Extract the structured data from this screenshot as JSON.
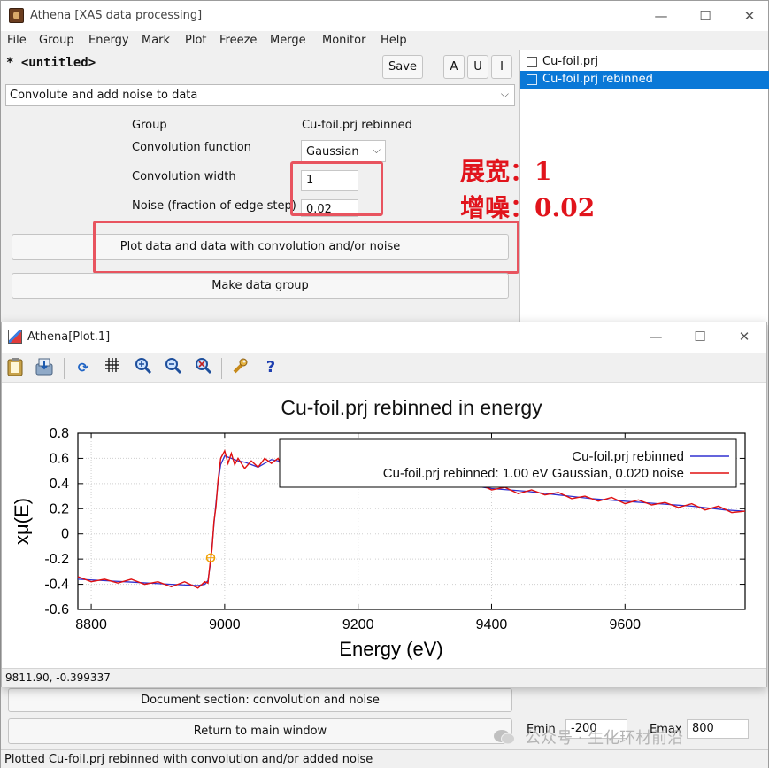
{
  "window": {
    "title": "Athena [XAS data processing]",
    "controls": {
      "minimize": "—",
      "maximize": "☐",
      "close": "✕"
    }
  },
  "menu": [
    "File",
    "Group",
    "Energy",
    "Mark",
    "Plot",
    "Freeze",
    "Merge",
    "Monitor",
    "Help"
  ],
  "project": {
    "name": "* <untitled>",
    "save_label": "Save",
    "a_label": "A",
    "u_label": "U",
    "i_label": "I"
  },
  "groups": [
    {
      "label": "Cu-foil.prj",
      "selected": false
    },
    {
      "label": "Cu-foil.prj rebinned",
      "selected": true
    }
  ],
  "tool_select": {
    "value": "Convolute and add noise to data"
  },
  "form": {
    "group_label": "Group",
    "group_value": "Cu-foil.prj rebinned",
    "function_label": "Convolution function",
    "function_value": "Gaussian",
    "width_label": "Convolution width",
    "width_value": "1",
    "noise_label": "Noise (fraction of edge step)",
    "noise_value": "0.02"
  },
  "buttons": {
    "plot": "Plot data and data with convolution and/or noise",
    "make_group": "Make data group",
    "document": "Document section: convolution and noise",
    "return": "Return to main window"
  },
  "annotations": {
    "line1": "展宽：1",
    "line2": "增噪：0.02"
  },
  "plot_window": {
    "title": "Athena[Plot.1]",
    "coordinates": "9811.90, -0.399337"
  },
  "emin": {
    "label": "Emin",
    "value": "-200"
  },
  "emax": {
    "label": "Emax",
    "value": "800"
  },
  "status": "Plotted Cu-foil.prj rebinned with convolution and/or added noise",
  "watermark": "公众号 · 生化环材前沿",
  "colors": {
    "selection": "#0a78d7",
    "highlight_box": "#e8545f",
    "annotation": "#e1141c",
    "series_original": "#3030d0",
    "series_noisy": "#e01010"
  },
  "chart_data": {
    "type": "line",
    "title": "Cu-foil.prj rebinned in energy",
    "xlabel": "Energy (eV)",
    "ylabel": "xμ(E)",
    "xlim": [
      8780,
      9780
    ],
    "ylim": [
      -0.6,
      0.8
    ],
    "xticks": [
      8800,
      9000,
      9200,
      9400,
      9600
    ],
    "yticks": [
      -0.6,
      -0.4,
      -0.2,
      0,
      0.2,
      0.4,
      0.6,
      0.8
    ],
    "grid": true,
    "legend_position": "top-right",
    "marker": {
      "x": 8979,
      "y": -0.19
    },
    "series": [
      {
        "name": "Cu-foil.prj rebinned",
        "color": "#3030d0",
        "x": [
          8780,
          8850,
          8920,
          8960,
          8970,
          8975,
          8978,
          8981,
          8984,
          8987,
          8990,
          8994,
          9000,
          9010,
          9020,
          9030,
          9040,
          9050,
          9060,
          9070,
          9080,
          9090,
          9100,
          9110,
          9120,
          9130,
          9140,
          9150,
          9160,
          9170,
          9180,
          9190,
          9200,
          9220,
          9240,
          9260,
          9280,
          9300,
          9350,
          9400,
          9450,
          9500,
          9550,
          9600,
          9650,
          9700,
          9750,
          9780
        ],
        "y": [
          -0.36,
          -0.38,
          -0.4,
          -0.41,
          -0.4,
          -0.37,
          -0.26,
          -0.1,
          0.08,
          0.25,
          0.4,
          0.55,
          0.62,
          0.6,
          0.58,
          0.57,
          0.55,
          0.53,
          0.56,
          0.59,
          0.58,
          0.53,
          0.45,
          0.51,
          0.57,
          0.59,
          0.56,
          0.42,
          0.46,
          0.52,
          0.54,
          0.51,
          0.47,
          0.49,
          0.47,
          0.46,
          0.45,
          0.44,
          0.4,
          0.36,
          0.34,
          0.31,
          0.28,
          0.26,
          0.24,
          0.22,
          0.19,
          0.18
        ]
      },
      {
        "name": "Cu-foil.prj rebinned: 1.00 eV Gaussian, 0.020 noise",
        "color": "#e01010",
        "x": [
          8780,
          8800,
          8820,
          8840,
          8860,
          8880,
          8900,
          8920,
          8940,
          8960,
          8970,
          8975,
          8978,
          8981,
          8984,
          8987,
          8990,
          8994,
          9000,
          9005,
          9010,
          9015,
          9020,
          9030,
          9040,
          9050,
          9060,
          9070,
          9080,
          9090,
          9100,
          9110,
          9120,
          9130,
          9140,
          9150,
          9160,
          9170,
          9180,
          9190,
          9200,
          9210,
          9220,
          9240,
          9260,
          9280,
          9300,
          9320,
          9340,
          9360,
          9380,
          9400,
          9420,
          9440,
          9460,
          9480,
          9500,
          9520,
          9540,
          9560,
          9580,
          9600,
          9620,
          9640,
          9660,
          9680,
          9700,
          9720,
          9740,
          9760,
          9780
        ],
        "y": [
          -0.34,
          -0.38,
          -0.36,
          -0.39,
          -0.36,
          -0.4,
          -0.38,
          -0.42,
          -0.38,
          -0.43,
          -0.38,
          -0.39,
          -0.24,
          -0.12,
          0.1,
          0.22,
          0.42,
          0.6,
          0.66,
          0.56,
          0.64,
          0.55,
          0.6,
          0.52,
          0.58,
          0.53,
          0.6,
          0.56,
          0.6,
          0.5,
          0.46,
          0.52,
          0.6,
          0.62,
          0.54,
          0.41,
          0.48,
          0.52,
          0.57,
          0.5,
          0.46,
          0.53,
          0.49,
          0.45,
          0.48,
          0.43,
          0.46,
          0.41,
          0.43,
          0.39,
          0.4,
          0.35,
          0.37,
          0.32,
          0.35,
          0.31,
          0.33,
          0.28,
          0.3,
          0.26,
          0.29,
          0.24,
          0.27,
          0.23,
          0.25,
          0.21,
          0.24,
          0.19,
          0.22,
          0.17,
          0.18
        ]
      }
    ]
  }
}
